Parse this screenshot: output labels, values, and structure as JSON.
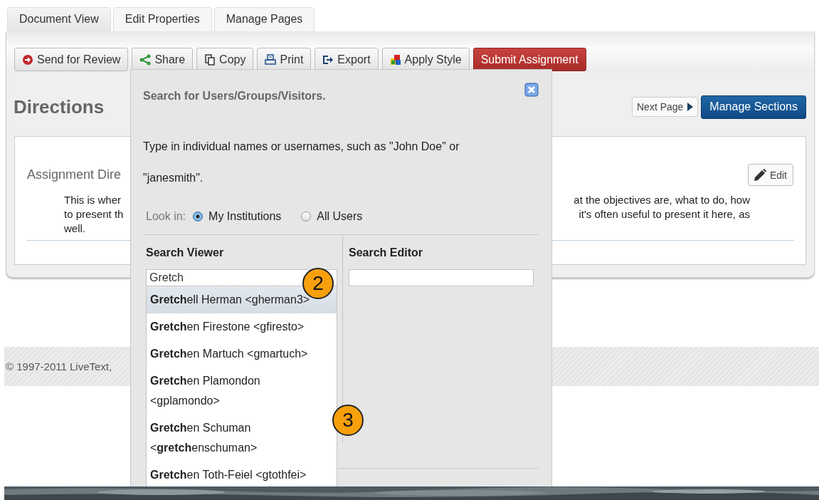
{
  "tabs": [
    {
      "label": "Document View",
      "selected": true
    },
    {
      "label": "Edit Properties",
      "selected": false
    },
    {
      "label": "Manage Pages",
      "selected": false
    }
  ],
  "toolbar": [
    {
      "kind": "review",
      "label": "Send for Review"
    },
    {
      "kind": "share",
      "label": "Share"
    },
    {
      "kind": "copy",
      "label": "Copy"
    },
    {
      "kind": "print",
      "label": "Print"
    },
    {
      "kind": "export",
      "label": "Export"
    },
    {
      "kind": "style",
      "label": "Apply Style"
    },
    {
      "kind": "submit",
      "label": "Submit Assignment"
    }
  ],
  "heading": "Directions",
  "next_page": "Next Page",
  "manage_sections": "Manage Sections",
  "section": {
    "title": "Assignment Dire",
    "edit": "Edit",
    "text_left": [
      "This is wher",
      "to present th",
      "well."
    ],
    "text_right": [
      "at the objectives are, what to do, how",
      "it's often useful to present it here, as"
    ]
  },
  "footer": "© 1997-2011 LiveText,",
  "dialog": {
    "title": "Search for Users/Groups/Visitors.",
    "hint": "Type in individual names or usernames, such as \"John Doe\" or \"janesmith\".",
    "look_in": "Look in:",
    "scopes": [
      {
        "label": "My Institutions",
        "selected": true
      },
      {
        "label": "All Users",
        "selected": false
      }
    ],
    "viewer": {
      "heading": "Search Viewer",
      "value": "Gretch"
    },
    "editor": {
      "heading": "Search Editor"
    },
    "suggestions": [
      {
        "text": "**Gretch**ell Herman <gherman3>",
        "selected": true
      },
      {
        "text": "**Gretch**en Firestone <gfiresto>",
        "selected": false
      },
      {
        "text": "**Gretch**en Martuch <gmartuch>",
        "selected": false
      },
      {
        "text": "**Gretch**en Plamondon <gplamondo>",
        "selected": false
      },
      {
        "text": "**Gretch**en Schuman <**gretch**enschuman>",
        "selected": false
      },
      {
        "text": "**Gretch**en Toth-Feiel <gtothfei>",
        "selected": false
      }
    ]
  },
  "callouts": [
    "2",
    "3"
  ]
}
